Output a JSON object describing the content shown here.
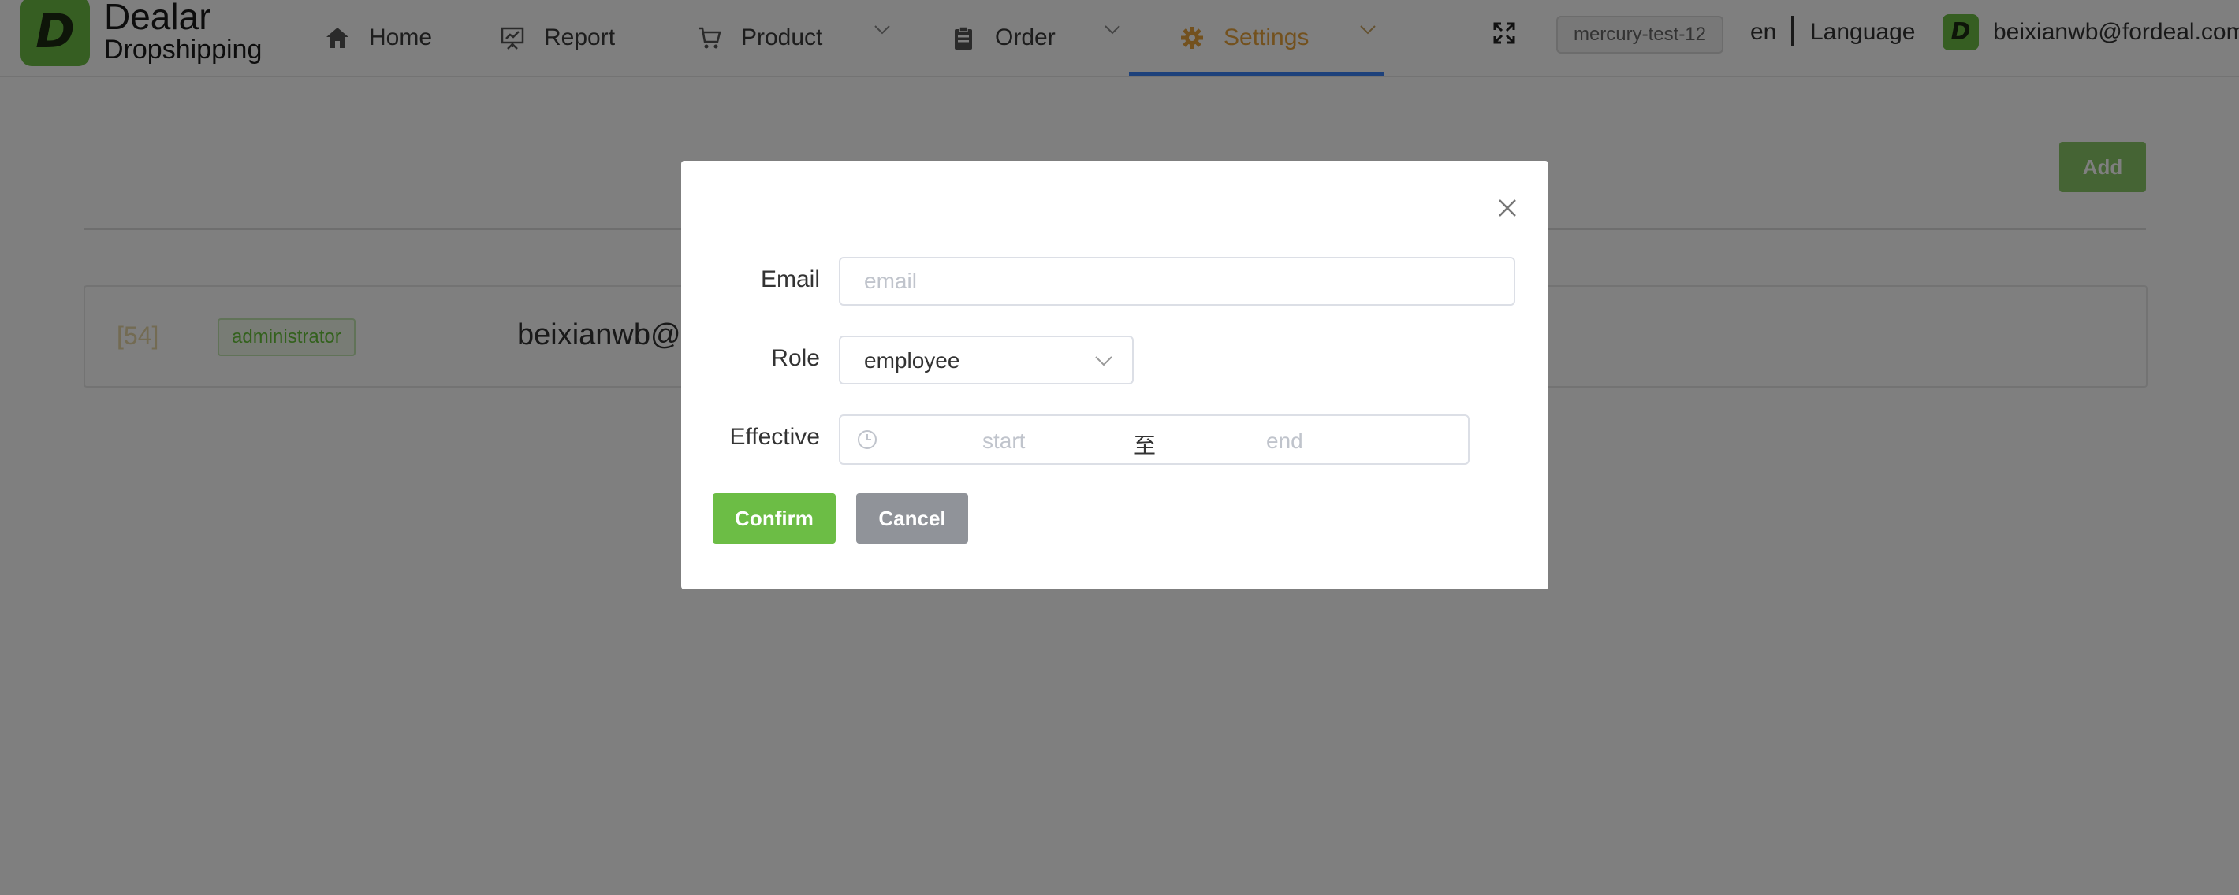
{
  "brand": {
    "mark": "D",
    "title": "Dealar",
    "subtitle": "Dropshipping"
  },
  "nav": {
    "items": [
      {
        "label": "Home",
        "icon": "home-icon"
      },
      {
        "label": "Report",
        "icon": "report-icon"
      },
      {
        "label": "Product",
        "icon": "cart-icon",
        "has_dropdown": true
      },
      {
        "label": "Order",
        "icon": "clipboard-icon",
        "has_dropdown": true
      },
      {
        "label": "Settings",
        "icon": "gear-icon",
        "has_dropdown": true,
        "active": true
      }
    ],
    "active_color": "#e6a23c",
    "underline_color": "#3b82f6"
  },
  "header": {
    "fullscreen_icon": "fullscreen-icon",
    "environment": "mercury-test-12",
    "language_code": "en",
    "language_label": "Language",
    "user_avatar": "D",
    "user_email": "beixianwb@fordeal.com"
  },
  "page": {
    "add_label": "Add",
    "rows": [
      {
        "id": "[54]",
        "role": "administrator",
        "email": "beixianwb@fordeal.com"
      }
    ]
  },
  "modal": {
    "email_label": "Email",
    "email_placeholder": "email",
    "email_value": "",
    "role_label": "Role",
    "role_value": "employee",
    "effective_label": "Effective",
    "range_start_placeholder": "start",
    "range_separator": "至",
    "range_end_placeholder": "end",
    "confirm_label": "Confirm",
    "cancel_label": "Cancel"
  },
  "colors": {
    "brand_green": "#6cbd45",
    "overlay": "rgba(0,0,0,0.5)",
    "cancel_gray": "#909399"
  }
}
